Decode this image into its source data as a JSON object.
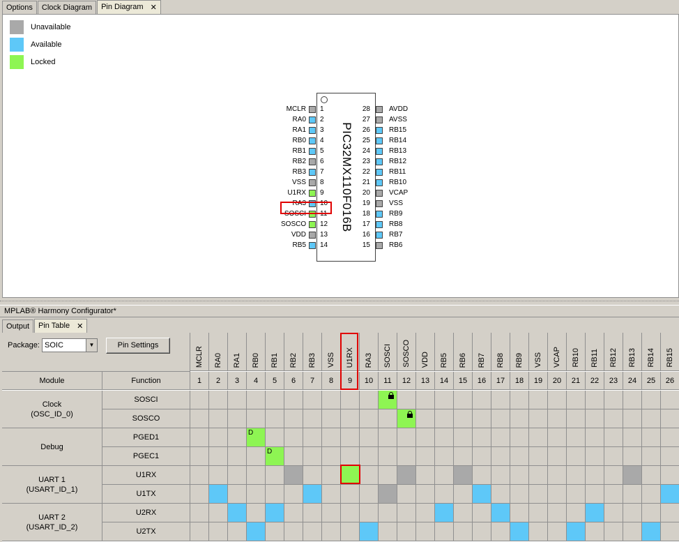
{
  "top_tabs": [
    {
      "label": "Options",
      "active": false
    },
    {
      "label": "Clock Diagram",
      "active": false
    },
    {
      "label": "Pin Diagram",
      "active": true
    }
  ],
  "legend": [
    {
      "label": "Unavailable",
      "color": "#a9a9a9"
    },
    {
      "label": "Available",
      "color": "#5ec8f8"
    },
    {
      "label": "Locked",
      "color": "#8ef553"
    }
  ],
  "chip": {
    "name": "PIC32MX110F016B"
  },
  "left_pins": [
    {
      "num": "1",
      "label": "MCLR",
      "state": "unavailable"
    },
    {
      "num": "2",
      "label": "RA0",
      "state": "available"
    },
    {
      "num": "3",
      "label": "RA1",
      "state": "available"
    },
    {
      "num": "4",
      "label": "RB0",
      "state": "available"
    },
    {
      "num": "5",
      "label": "RB1",
      "state": "available"
    },
    {
      "num": "6",
      "label": "RB2",
      "state": "unavailable"
    },
    {
      "num": "7",
      "label": "RB3",
      "state": "available"
    },
    {
      "num": "8",
      "label": "VSS",
      "state": "unavailable"
    },
    {
      "num": "9",
      "label": "U1RX",
      "state": "locked"
    },
    {
      "num": "10",
      "label": "RA3",
      "state": "available"
    },
    {
      "num": "11",
      "label": "SOSCI",
      "state": "locked"
    },
    {
      "num": "12",
      "label": "SOSCO",
      "state": "locked"
    },
    {
      "num": "13",
      "label": "VDD",
      "state": "unavailable"
    },
    {
      "num": "14",
      "label": "RB5",
      "state": "available"
    }
  ],
  "right_pins": [
    {
      "num": "28",
      "label": "AVDD",
      "state": "unavailable"
    },
    {
      "num": "27",
      "label": "AVSS",
      "state": "unavailable"
    },
    {
      "num": "26",
      "label": "RB15",
      "state": "available"
    },
    {
      "num": "25",
      "label": "RB14",
      "state": "available"
    },
    {
      "num": "24",
      "label": "RB13",
      "state": "available"
    },
    {
      "num": "23",
      "label": "RB12",
      "state": "available"
    },
    {
      "num": "22",
      "label": "RB11",
      "state": "available"
    },
    {
      "num": "21",
      "label": "RB10",
      "state": "available"
    },
    {
      "num": "20",
      "label": "VCAP",
      "state": "unavailable"
    },
    {
      "num": "19",
      "label": "VSS",
      "state": "unavailable"
    },
    {
      "num": "18",
      "label": "RB9",
      "state": "available"
    },
    {
      "num": "17",
      "label": "RB8",
      "state": "available"
    },
    {
      "num": "16",
      "label": "RB7",
      "state": "available"
    },
    {
      "num": "15",
      "label": "RB6",
      "state": "unavailable"
    }
  ],
  "harmony_title": "MPLAB® Harmony Configurator*",
  "bottom_tabs": [
    {
      "label": "Output",
      "active": false
    },
    {
      "label": "Pin Table",
      "active": true
    }
  ],
  "pin_table": {
    "package_label": "Package:",
    "package_value": "SOIC",
    "pin_settings_label": "Pin Settings",
    "module_header": "Module",
    "function_header": "Function",
    "columns": [
      {
        "name": "MCLR",
        "num": "1"
      },
      {
        "name": "RA0",
        "num": "2"
      },
      {
        "name": "RA1",
        "num": "3"
      },
      {
        "name": "RB0",
        "num": "4"
      },
      {
        "name": "RB1",
        "num": "5"
      },
      {
        "name": "RB2",
        "num": "6"
      },
      {
        "name": "RB3",
        "num": "7"
      },
      {
        "name": "VSS",
        "num": "8"
      },
      {
        "name": "U1RX",
        "num": "9"
      },
      {
        "name": "RA3",
        "num": "10"
      },
      {
        "name": "SOSCI",
        "num": "11"
      },
      {
        "name": "SOSCO",
        "num": "12"
      },
      {
        "name": "VDD",
        "num": "13"
      },
      {
        "name": "RB5",
        "num": "14"
      },
      {
        "name": "RB6",
        "num": "15"
      },
      {
        "name": "RB7",
        "num": "16"
      },
      {
        "name": "RB8",
        "num": "17"
      },
      {
        "name": "RB9",
        "num": "18"
      },
      {
        "name": "VSS",
        "num": "19"
      },
      {
        "name": "VCAP",
        "num": "20"
      },
      {
        "name": "RB10",
        "num": "21"
      },
      {
        "name": "RB11",
        "num": "22"
      },
      {
        "name": "RB12",
        "num": "23"
      },
      {
        "name": "RB13",
        "num": "24"
      },
      {
        "name": "RB14",
        "num": "25"
      },
      {
        "name": "RB15",
        "num": "26"
      }
    ],
    "modules": [
      {
        "name": "Clock",
        "id": "(OSC_ID_0)",
        "functions": [
          {
            "name": "SOSCI",
            "cells": {
              "10": {
                "color": "locked",
                "lock": true
              }
            }
          },
          {
            "name": "SOSCO",
            "cells": {
              "11": {
                "color": "locked",
                "lock": true
              }
            }
          }
        ]
      },
      {
        "name": "Debug",
        "id": "",
        "functions": [
          {
            "name": "PGED1",
            "cells": {
              "3": {
                "color": "locked",
                "letter": "D"
              }
            }
          },
          {
            "name": "PGEC1",
            "cells": {
              "4": {
                "color": "locked",
                "letter": "D"
              }
            }
          }
        ]
      },
      {
        "name": "UART 1",
        "id": "(USART_ID_1)",
        "functions": [
          {
            "name": "U1RX",
            "cells": {
              "5": {
                "color": "unavailable"
              },
              "8": {
                "color": "locked"
              },
              "11": {
                "color": "unavailable"
              },
              "14": {
                "color": "unavailable"
              },
              "23": {
                "color": "unavailable"
              }
            }
          },
          {
            "name": "U1TX",
            "cells": {
              "1": {
                "color": "available"
              },
              "6": {
                "color": "available"
              },
              "10": {
                "color": "unavailable"
              },
              "15": {
                "color": "available"
              },
              "25": {
                "color": "available"
              }
            }
          }
        ]
      },
      {
        "name": "UART 2",
        "id": "(USART_ID_2)",
        "functions": [
          {
            "name": "U2RX",
            "cells": {
              "2": {
                "color": "available"
              },
              "4": {
                "color": "available"
              },
              "13": {
                "color": "available"
              },
              "16": {
                "color": "available"
              },
              "21": {
                "color": "available"
              }
            }
          },
          {
            "name": "U2TX",
            "cells": {
              "3": {
                "color": "available"
              },
              "9": {
                "color": "available"
              },
              "17": {
                "color": "available"
              },
              "20": {
                "color": "available"
              },
              "24": {
                "color": "available"
              }
            }
          }
        ]
      }
    ]
  },
  "colors": {
    "unavailable": "#a9a9a9",
    "available": "#5ec8f8",
    "locked": "#8ef553",
    "cell": "#d4d0c8",
    "highlight": "#e00000"
  }
}
